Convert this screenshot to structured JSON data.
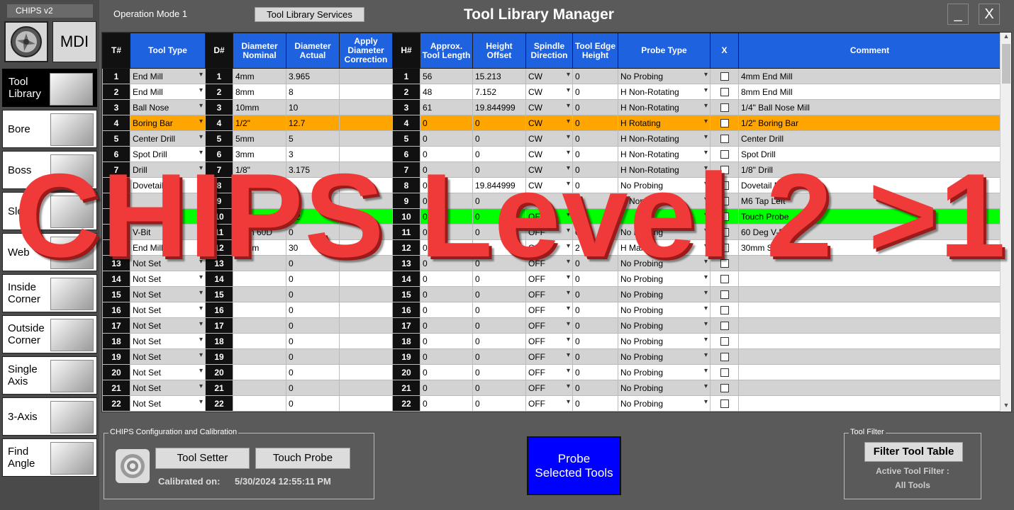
{
  "app": {
    "title": "CHIPS v2"
  },
  "sidebar": {
    "mdi_label": "MDI",
    "items": [
      {
        "label": "Tool Library",
        "icon": "tool-library-icon",
        "active": true
      },
      {
        "label": "Bore",
        "icon": "bore-icon"
      },
      {
        "label": "Boss",
        "icon": "boss-icon"
      },
      {
        "label": "Slot",
        "icon": "slot-icon"
      },
      {
        "label": "Web",
        "icon": "web-icon"
      },
      {
        "label": "Inside Corner",
        "icon": "inside-corner-icon"
      },
      {
        "label": "Outside Corner",
        "icon": "outside-corner-icon"
      },
      {
        "label": "Single Axis",
        "icon": "single-axis-icon"
      },
      {
        "label": "3-Axis",
        "icon": "three-axis-icon"
      },
      {
        "label": "Find Angle",
        "icon": "find-angle-icon"
      }
    ]
  },
  "header": {
    "operation_mode": "Operation Mode 1",
    "tool_library_services": "Tool Library Services",
    "window_title": "Tool Library Manager",
    "minimize": "_",
    "close": "X"
  },
  "table": {
    "columns": [
      "T#",
      "Tool Type",
      "D#",
      "Diameter Nominal",
      "Diameter Actual",
      "Apply Diameter Correction",
      "H#",
      "Approx. Tool Length",
      "Height Offset",
      "Spindle Direction",
      "Tool Edge Height",
      "Probe Type",
      "X",
      "Comment"
    ],
    "rows": [
      {
        "t": "1",
        "type": "End Mill",
        "d": "1",
        "dnom": "4mm",
        "dact": "3.965",
        "h": "1",
        "len": "56",
        "hoff": "15.213",
        "spin": "CW",
        "edge": "0",
        "probe": "No Probing",
        "comment": "4mm End Mill"
      },
      {
        "t": "2",
        "type": "End Mill",
        "d": "2",
        "dnom": "8mm",
        "dact": "8",
        "h": "2",
        "len": "48",
        "hoff": "7.152",
        "spin": "CW",
        "edge": "0",
        "probe": "H Non-Rotating",
        "comment": "8mm End Mill"
      },
      {
        "t": "3",
        "type": "Ball Nose",
        "d": "3",
        "dnom": "10mm",
        "dact": "10",
        "h": "3",
        "len": "61",
        "hoff": "19.844999",
        "spin": "CW",
        "edge": "0",
        "probe": "H Non-Rotating",
        "comment": "1/4\" Ball Nose Mill"
      },
      {
        "t": "4",
        "type": "Boring Bar",
        "d": "4",
        "dnom": "1/2\"",
        "dact": "12.7",
        "h": "4",
        "len": "0",
        "hoff": "0",
        "spin": "CW",
        "edge": "0",
        "probe": "H Rotating",
        "comment": "1/2\" Boring Bar",
        "state": "sel"
      },
      {
        "t": "5",
        "type": "Center Drill",
        "d": "5",
        "dnom": "5mm",
        "dact": "5",
        "h": "5",
        "len": "0",
        "hoff": "0",
        "spin": "CW",
        "edge": "0",
        "probe": "H Non-Rotating",
        "comment": "Center Drill"
      },
      {
        "t": "6",
        "type": "Spot Drill",
        "d": "6",
        "dnom": "3mm",
        "dact": "3",
        "h": "6",
        "len": "0",
        "hoff": "0",
        "spin": "CW",
        "edge": "0",
        "probe": "H Non-Rotating",
        "comment": "Spot Drill"
      },
      {
        "t": "7",
        "type": "Drill",
        "d": "7",
        "dnom": "1/8\"",
        "dact": "3.175",
        "h": "7",
        "len": "0",
        "hoff": "0",
        "spin": "CW",
        "edge": "0",
        "probe": "H Non-Rotating",
        "comment": "1/8\" Drill"
      },
      {
        "t": "8",
        "type": "Dovetail",
        "d": "8",
        "dnom": "10",
        "dact": "",
        "h": "8",
        "len": "0",
        "hoff": "19.844999",
        "spin": "CW",
        "edge": "0",
        "probe": "No Probing",
        "comment": "Dovetail Mill"
      },
      {
        "t": "9",
        "type": "",
        "d": "9",
        "dnom": "M6",
        "dact": "",
        "h": "9",
        "len": "0",
        "hoff": "0",
        "spin": "CW",
        "edge": "0",
        "probe": "H Non-Rotating",
        "comment": "M6 Tap Left"
      },
      {
        "t": "10",
        "type": "Probe",
        "d": "10",
        "dnom": "",
        "dact": "3.2",
        "h": "10",
        "len": "0",
        "hoff": "0",
        "spin": "OFF",
        "edge": "0",
        "probe": "",
        "comment": "Touch Probe",
        "state": "probe"
      },
      {
        "t": "11",
        "type": "V-Bit",
        "d": "11",
        "dnom": "5mm 60D",
        "dact": "0",
        "h": "11",
        "len": "0",
        "hoff": "0",
        "spin": "OFF",
        "edge": "0",
        "probe": "No Probing",
        "comment": "60 Deg V-Bit"
      },
      {
        "t": "12",
        "type": "End Mill",
        "d": "12",
        "dnom": "30mm",
        "dact": "30",
        "h": "12",
        "len": "0",
        "hoff": "0",
        "spin": "OFF",
        "edge": "2",
        "probe": "H Manual",
        "comment": "30mm Shell Mill"
      },
      {
        "t": "13",
        "type": "Not Set",
        "d": "13",
        "dnom": "",
        "dact": "0",
        "h": "13",
        "len": "0",
        "hoff": "0",
        "spin": "OFF",
        "edge": "0",
        "probe": "No Probing",
        "comment": ""
      },
      {
        "t": "14",
        "type": "Not Set",
        "d": "14",
        "dnom": "",
        "dact": "0",
        "h": "14",
        "len": "0",
        "hoff": "0",
        "spin": "OFF",
        "edge": "0",
        "probe": "No Probing",
        "comment": ""
      },
      {
        "t": "15",
        "type": "Not Set",
        "d": "15",
        "dnom": "",
        "dact": "0",
        "h": "15",
        "len": "0",
        "hoff": "0",
        "spin": "OFF",
        "edge": "0",
        "probe": "No Probing",
        "comment": ""
      },
      {
        "t": "16",
        "type": "Not Set",
        "d": "16",
        "dnom": "",
        "dact": "0",
        "h": "16",
        "len": "0",
        "hoff": "0",
        "spin": "OFF",
        "edge": "0",
        "probe": "No Probing",
        "comment": ""
      },
      {
        "t": "17",
        "type": "Not Set",
        "d": "17",
        "dnom": "",
        "dact": "0",
        "h": "17",
        "len": "0",
        "hoff": "0",
        "spin": "OFF",
        "edge": "0",
        "probe": "No Probing",
        "comment": ""
      },
      {
        "t": "18",
        "type": "Not Set",
        "d": "18",
        "dnom": "",
        "dact": "0",
        "h": "18",
        "len": "0",
        "hoff": "0",
        "spin": "OFF",
        "edge": "0",
        "probe": "No Probing",
        "comment": ""
      },
      {
        "t": "19",
        "type": "Not Set",
        "d": "19",
        "dnom": "",
        "dact": "0",
        "h": "19",
        "len": "0",
        "hoff": "0",
        "spin": "OFF",
        "edge": "0",
        "probe": "No Probing",
        "comment": ""
      },
      {
        "t": "20",
        "type": "Not Set",
        "d": "20",
        "dnom": "",
        "dact": "0",
        "h": "20",
        "len": "0",
        "hoff": "0",
        "spin": "OFF",
        "edge": "0",
        "probe": "No Probing",
        "comment": ""
      },
      {
        "t": "21",
        "type": "Not Set",
        "d": "21",
        "dnom": "",
        "dact": "0",
        "h": "21",
        "len": "0",
        "hoff": "0",
        "spin": "OFF",
        "edge": "0",
        "probe": "No Probing",
        "comment": ""
      },
      {
        "t": "22",
        "type": "Not Set",
        "d": "22",
        "dnom": "",
        "dact": "0",
        "h": "22",
        "len": "0",
        "hoff": "0",
        "spin": "OFF",
        "edge": "0",
        "probe": "No Probing",
        "comment": ""
      }
    ]
  },
  "watermark": "CHIPS Level 2 >1",
  "config": {
    "legend": "CHIPS Configuration and Calibration",
    "tool_setter": "Tool Setter",
    "touch_probe": "Touch Probe",
    "calibrated_label": "Calibrated on:",
    "calibrated_value": "5/30/2024 12:55:11 PM"
  },
  "probe_selected": {
    "line1": "Probe",
    "line2": "Selected Tools"
  },
  "filter": {
    "legend": "Tool Filter",
    "button": "Filter Tool Table",
    "active_label": "Active Tool Filter :",
    "active_value": "All Tools"
  },
  "colors": {
    "header_blue": "#1e62e0",
    "selected_row": "#ffa500",
    "probe_row": "#00ff00",
    "probe_button": "#0000ff",
    "watermark": "#f03a3a"
  }
}
